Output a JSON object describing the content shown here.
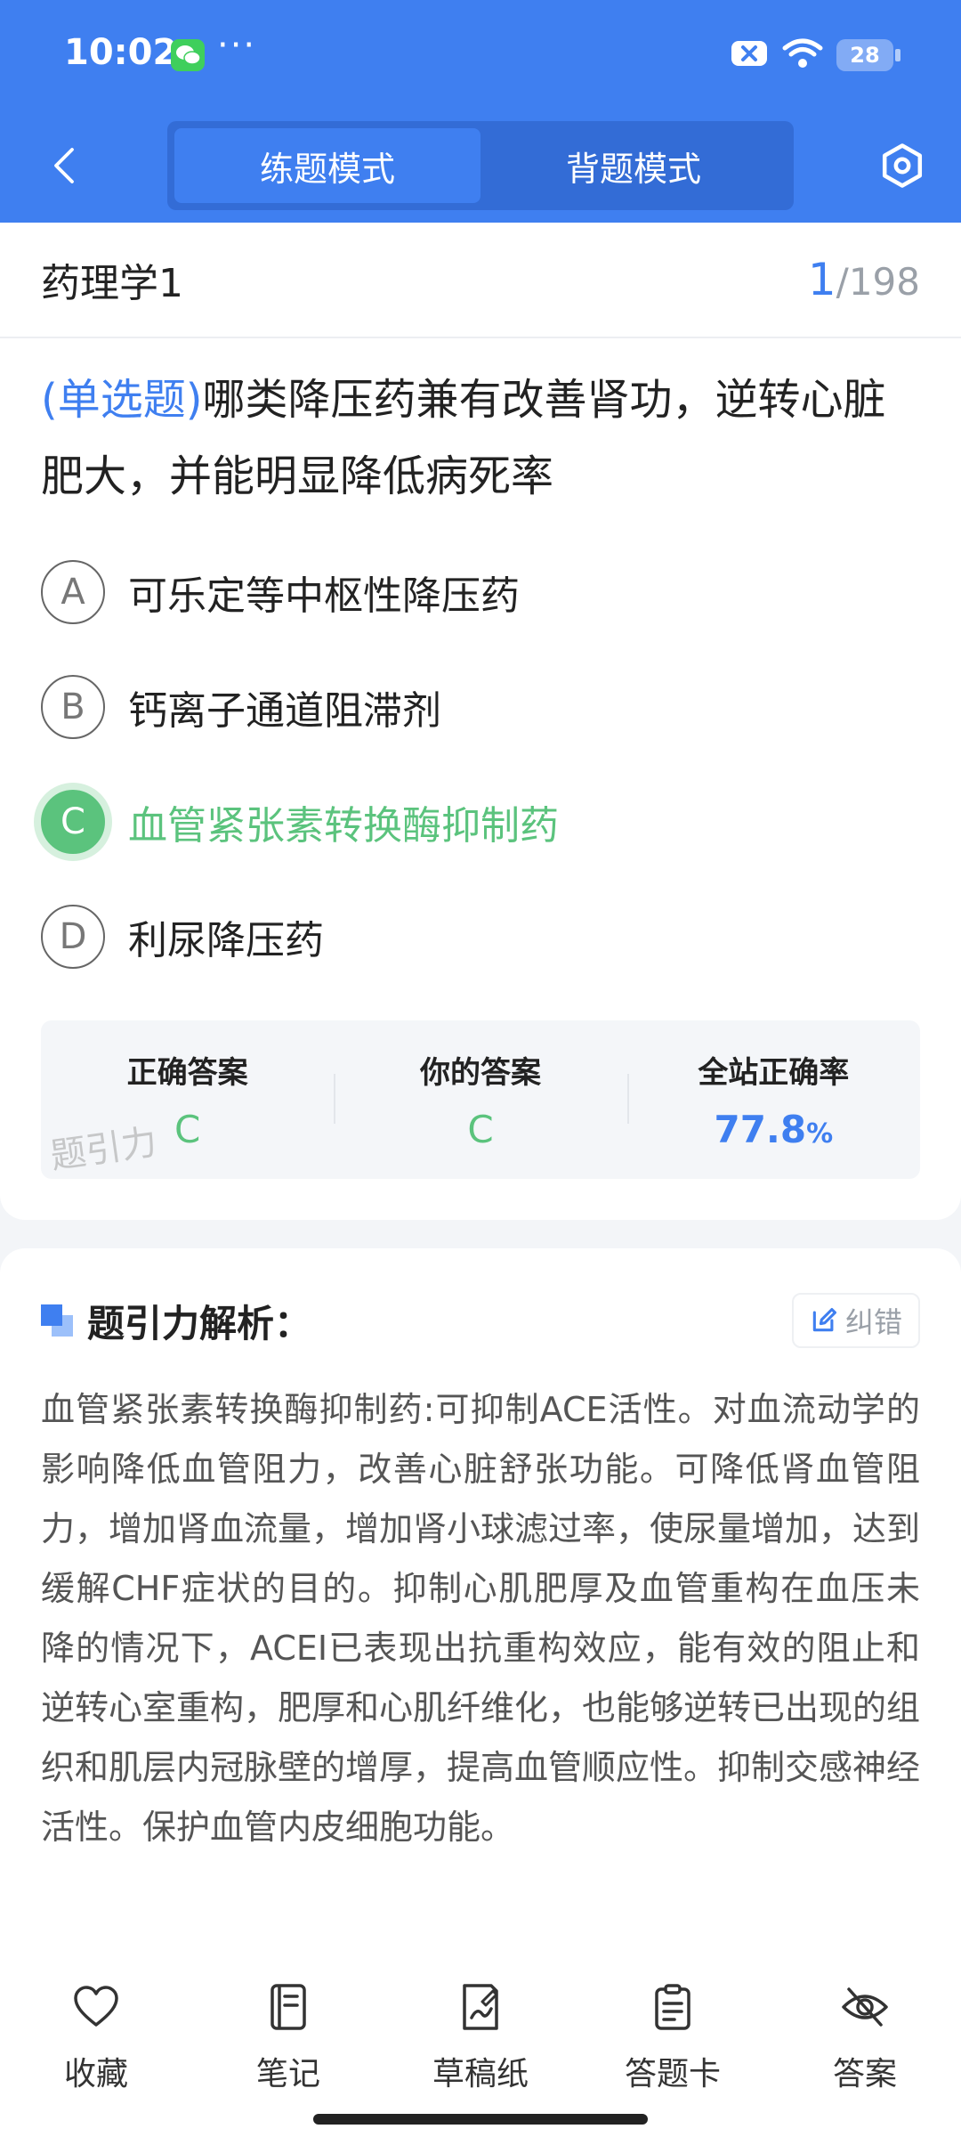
{
  "status": {
    "time": "10:02",
    "more": "···",
    "battery": "28"
  },
  "nav": {
    "tabs": [
      {
        "label": "练题模式",
        "active": true
      },
      {
        "label": "背题模式",
        "active": false
      }
    ]
  },
  "question": {
    "subject": "药理学1",
    "current": "1",
    "total": "/198",
    "type": "(单选题)",
    "text": "哪类降压药兼有改善肾功，逆转心脏肥大，并能明显降低病死率",
    "options": [
      {
        "letter": "A",
        "text": "可乐定等中枢性降压药",
        "state": "normal"
      },
      {
        "letter": "B",
        "text": "钙离子通道阻滞剂",
        "state": "normal"
      },
      {
        "letter": "C",
        "text": "血管紧张素转换酶抑制药",
        "state": "correct"
      },
      {
        "letter": "D",
        "text": "利尿降压药",
        "state": "normal"
      }
    ]
  },
  "answers": {
    "correct_label": "正确答案",
    "correct_value": "C",
    "yours_label": "你的答案",
    "yours_value": "C",
    "rate_label": "全站正确率",
    "rate_value": "77.8",
    "rate_unit": "%",
    "watermark": "题引力"
  },
  "analysis": {
    "title": "题引力解析：",
    "report_label": "纠错",
    "body": "血管紧张素转换酶抑制药:可抑制ACE活性。对血流动学的影响降低血管阻力，改善心脏舒张功能。可降低肾血管阻力，增加肾血流量，增加肾小球滤过率，使尿量增加，达到缓解CHF症状的目的。抑制心肌肥厚及血管重构在血压未降的情况下，ACEI已表现出抗重构效应，能有效的阻止和逆转心室重构，肥厚和心肌纤维化，也能够逆转已出现的组织和肌层内冠脉壁的增厚，提高血管顺应性。抑制交感神经活性。保护血管内皮细胞功能。"
  },
  "toolbar": {
    "favorite": "收藏",
    "notes": "笔记",
    "draft": "草稿纸",
    "answer_card": "答题卡",
    "answer": "答案"
  },
  "colors": {
    "brand": "#3f7ff0",
    "correct": "#5bc37d"
  }
}
